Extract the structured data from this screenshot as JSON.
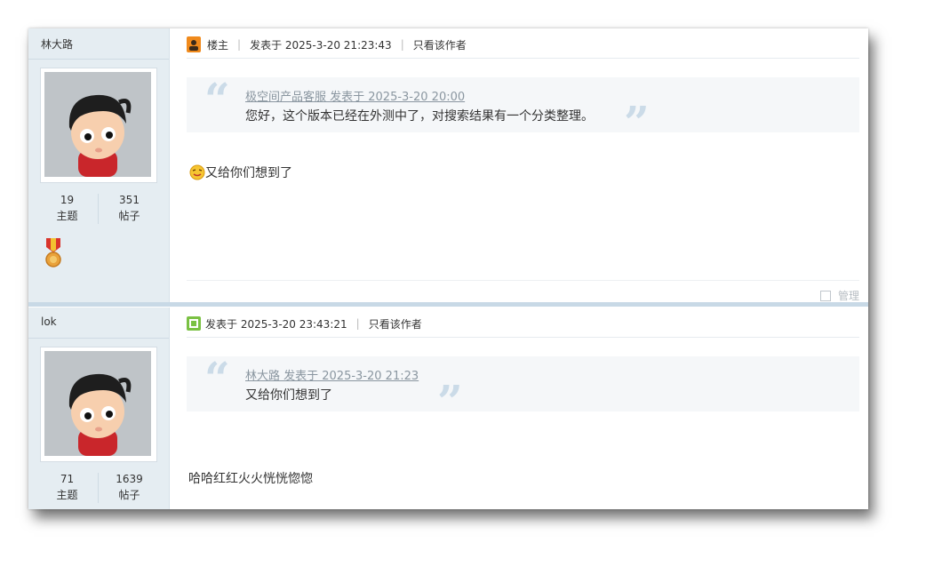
{
  "posts": [
    {
      "author": "林大路",
      "stats": {
        "topics_count": "19",
        "topics_label": "主题",
        "posts_count": "351",
        "posts_label": "帖子"
      },
      "role": "楼主",
      "posted_at": "发表于 2025-3-20 21:23:43",
      "only_author": "只看该作者",
      "quote": {
        "source": "极空间产品客服 发表于 2025-3-20 20:00",
        "text": "您好，这个版本已经在外测中了，对搜索结果有一个分类整理。"
      },
      "body": "又给你们想到了",
      "manage": "管理"
    },
    {
      "author": "lok",
      "stats": {
        "topics_count": "71",
        "topics_label": "主题",
        "posts_count": "1639",
        "posts_label": "帖子"
      },
      "posted_at": "发表于 2025-3-20 23:43:21",
      "only_author": "只看该作者",
      "quote": {
        "source": "林大路 发表于 2025-3-20 21:23",
        "text": "又给你们想到了"
      },
      "body": "哈哈红红火火恍恍惚惚"
    }
  ],
  "icons": {
    "owner": "owner-badge-icon",
    "post": "post-icon",
    "medal": "medal-icon",
    "emoji": "smiley-icon",
    "quote_open": "quote-open-icon",
    "quote_close": "quote-close-icon"
  },
  "colors": {
    "sidebar_bg": "#e5edf2",
    "quote_bg": "#f5f7f9",
    "owner_badge": "#f08a1c",
    "post_icon": "#7ac143"
  }
}
